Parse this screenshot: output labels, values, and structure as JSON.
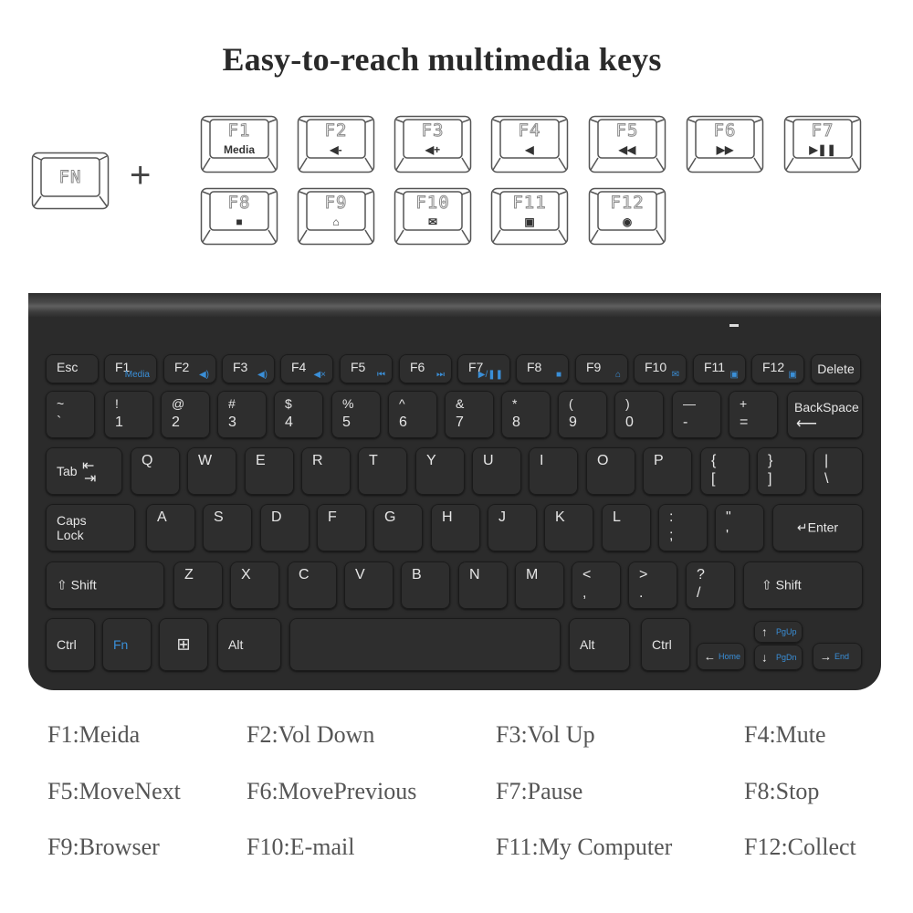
{
  "title": "Easy-to-reach multimedia keys",
  "combo": {
    "fn_key": "FN",
    "plus": "+",
    "keys": [
      {
        "label": "F1",
        "sub": "Media",
        "icon": "media-text"
      },
      {
        "label": "F2",
        "sub": "◀-",
        "icon": "volume-down-icon"
      },
      {
        "label": "F3",
        "sub": "◀+",
        "icon": "volume-up-icon"
      },
      {
        "label": "F4",
        "sub": "◀",
        "icon": "mute-icon"
      },
      {
        "label": "F5",
        "sub": "◀◀",
        "icon": "rewind-icon"
      },
      {
        "label": "F6",
        "sub": "▶▶",
        "icon": "fast-forward-icon"
      },
      {
        "label": "F7",
        "sub": "▶❚❚",
        "icon": "play-pause-icon"
      },
      {
        "label": "F8",
        "sub": "■",
        "icon": "stop-icon"
      },
      {
        "label": "F9",
        "sub": "⌂",
        "icon": "home-icon"
      },
      {
        "label": "F10",
        "sub": "✉",
        "icon": "mail-icon"
      },
      {
        "label": "F11",
        "sub": "▣",
        "icon": "computer-icon"
      },
      {
        "label": "F12",
        "sub": "◉",
        "icon": "collect-icon"
      }
    ]
  },
  "keyboard": {
    "fn_row": [
      {
        "label": "Esc"
      },
      {
        "label": "F1",
        "sub": "Media"
      },
      {
        "label": "F2",
        "sub": "◀)"
      },
      {
        "label": "F3",
        "sub": "◀)"
      },
      {
        "label": "F4",
        "sub": "◀×"
      },
      {
        "label": "F5",
        "sub": "⏮"
      },
      {
        "label": "F6",
        "sub": "⏭"
      },
      {
        "label": "F7",
        "sub": "▶/❚❚"
      },
      {
        "label": "F8",
        "sub": "■"
      },
      {
        "label": "F9",
        "sub": "⌂"
      },
      {
        "label": "F10",
        "sub": "✉"
      },
      {
        "label": "F11",
        "sub": "▣"
      },
      {
        "label": "F12",
        "sub": "▣"
      },
      {
        "label": "Delete"
      }
    ],
    "num_row": [
      {
        "top": "~",
        "bottom": "`"
      },
      {
        "top": "!",
        "bottom": "1"
      },
      {
        "top": "@",
        "bottom": "2"
      },
      {
        "top": "#",
        "bottom": "3"
      },
      {
        "top": "$",
        "bottom": "4"
      },
      {
        "top": "%",
        "bottom": "5"
      },
      {
        "top": "^",
        "bottom": "6"
      },
      {
        "top": "&",
        "bottom": "7"
      },
      {
        "top": "*",
        "bottom": "8"
      },
      {
        "top": "(",
        "bottom": "9"
      },
      {
        "top": ")",
        "bottom": "0"
      },
      {
        "top": "—",
        "bottom": "-"
      },
      {
        "top": "+",
        "bottom": "="
      },
      {
        "top": "BackSpace",
        "bottom": "⟵"
      }
    ],
    "q_row": [
      {
        "top": "Tab",
        "bottom": ""
      },
      {
        "top": "Q"
      },
      {
        "top": "W"
      },
      {
        "top": "E"
      },
      {
        "top": "R"
      },
      {
        "top": "T"
      },
      {
        "top": "Y"
      },
      {
        "top": "U"
      },
      {
        "top": "I"
      },
      {
        "top": "O"
      },
      {
        "top": "P"
      },
      {
        "top": "{",
        "bottom": "["
      },
      {
        "top": "}",
        "bottom": "]"
      },
      {
        "top": "|",
        "bottom": "\\"
      }
    ],
    "tab_arrows": "⇤\n⇥",
    "a_row": [
      {
        "top": "Caps",
        "bottom": "Lock"
      },
      {
        "top": "A"
      },
      {
        "top": "S"
      },
      {
        "top": "D"
      },
      {
        "top": "F"
      },
      {
        "top": "G"
      },
      {
        "top": "H"
      },
      {
        "top": "J"
      },
      {
        "top": "K"
      },
      {
        "top": "L"
      },
      {
        "top": ":",
        "bottom": ";"
      },
      {
        "top": "\"",
        "bottom": "'"
      },
      {
        "top": "↵Enter"
      }
    ],
    "z_row": [
      {
        "top": "⇧  Shift"
      },
      {
        "top": "Z"
      },
      {
        "top": "X"
      },
      {
        "top": "C"
      },
      {
        "top": "V"
      },
      {
        "top": "B"
      },
      {
        "top": "N"
      },
      {
        "top": "M"
      },
      {
        "top": "<",
        "bottom": ","
      },
      {
        "top": ">",
        "bottom": "."
      },
      {
        "top": "?",
        "bottom": "/"
      },
      {
        "top": "⇧  Shift"
      }
    ],
    "bottom_row": {
      "ctrl_left": "Ctrl",
      "fn": "Fn",
      "win": "⊞",
      "alt_left": "Alt",
      "space": "",
      "alt_right": "Alt",
      "ctrl_right": "Ctrl",
      "left": {
        "arrow": "←",
        "label": "Home"
      },
      "up": {
        "arrow": "↑",
        "label": "PgUp"
      },
      "down": {
        "arrow": "↓",
        "label": "PgDn"
      },
      "right": {
        "arrow": "→",
        "label": "End"
      }
    }
  },
  "legend": [
    [
      "F1:Meida",
      "F2:Vol Down",
      "F3:Vol Up",
      "F4:Mute"
    ],
    [
      "F5:MoveNext",
      "F6:MovePrevious",
      "F7:Pause",
      "F8:Stop"
    ],
    [
      "F9:Browser",
      "F10:E-mail",
      "F11:My Computer",
      "F12:Collect"
    ]
  ],
  "colors": {
    "accent_blue": "#3a8fd8",
    "keyboard": "#2b2b2b"
  }
}
